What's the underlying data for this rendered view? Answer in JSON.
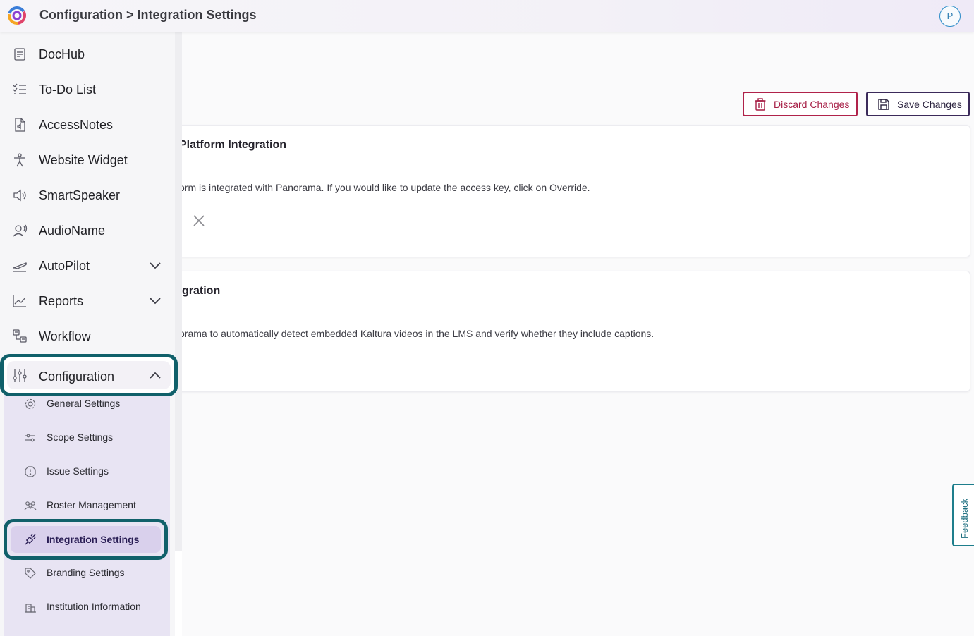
{
  "header": {
    "title": "Configuration > Integration Settings",
    "avatar_initial": "P"
  },
  "toolbar": {
    "discard_label": "Discard Changes",
    "save_label": "Save Changes"
  },
  "cards": [
    {
      "title": "Platform Integration",
      "description": "orm is integrated with Panorama. If you would like to update the access key, click on Override."
    },
    {
      "title": "gration",
      "description": "orama to automatically detect embedded Kaltura videos in the LMS and verify whether they include captions."
    }
  ],
  "sidebar": {
    "items": [
      {
        "label": "DocHub",
        "icon": "document-icon"
      },
      {
        "label": "To-Do List",
        "icon": "checklist-icon"
      },
      {
        "label": "AccessNotes",
        "icon": "audio-file-icon"
      },
      {
        "label": "Website Widget",
        "icon": "accessibility-person-icon"
      },
      {
        "label": "SmartSpeaker",
        "icon": "speaker-icon"
      },
      {
        "label": "AudioName",
        "icon": "user-voice-icon"
      },
      {
        "label": "AutoPilot",
        "icon": "plane-icon"
      },
      {
        "label": "Reports",
        "icon": "line-chart-icon"
      },
      {
        "label": "Workflow",
        "icon": "workflow-icon"
      },
      {
        "label": "Configuration",
        "icon": "sliders-icon"
      }
    ],
    "submenu": [
      {
        "label": "General Settings",
        "icon": "gear-icon"
      },
      {
        "label": "Scope Settings",
        "icon": "sliders-icon"
      },
      {
        "label": "Issue Settings",
        "icon": "warning-icon"
      },
      {
        "label": "Roster Management",
        "icon": "users-icon"
      },
      {
        "label": "Integration Settings",
        "icon": "plug-icon"
      },
      {
        "label": "Branding Settings",
        "icon": "tag-icon"
      },
      {
        "label": "Institution Information",
        "icon": "building-icon"
      }
    ]
  },
  "feedback": {
    "label": "Feedback"
  },
  "colors": {
    "discard": "#a61d44",
    "save": "#2d2540",
    "highlight": "#10606a",
    "active_sub_bg": "#d9d0ec",
    "submenu_bg": "#e8e4f3"
  }
}
